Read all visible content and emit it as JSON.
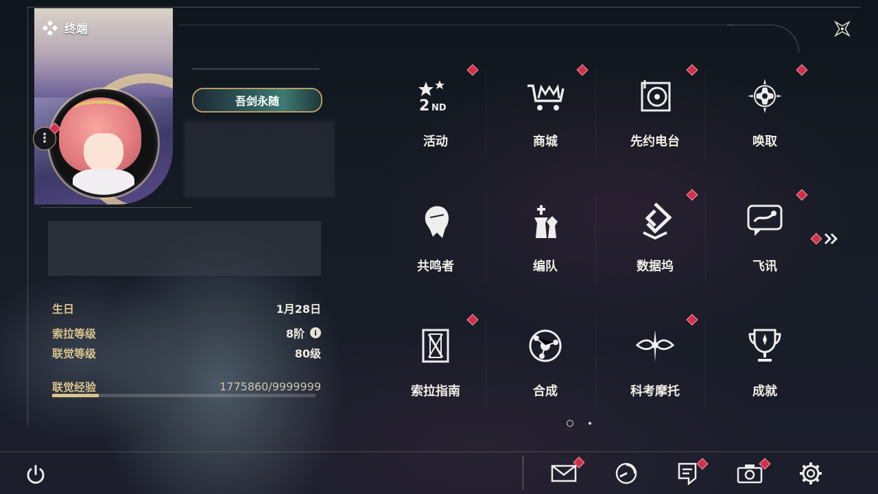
{
  "header": {
    "terminal_label": "终端",
    "close_icon": "close-x-icon"
  },
  "profile": {
    "title_badge": "吾剑永随",
    "avatar": "character-avatar",
    "stats": [
      {
        "label": "生日",
        "value": "1月28日"
      },
      {
        "label": "索拉等级",
        "value": "8阶"
      },
      {
        "label": "联觉等级",
        "value": "80级"
      }
    ],
    "exp": {
      "label": "联觉经验",
      "value": "1775860/9999999",
      "fraction": 0.1776
    }
  },
  "menu": [
    {
      "label": "活动",
      "icon": "event-2nd-anniversary-icon",
      "badge": true
    },
    {
      "label": "商城",
      "icon": "shop-cart-icon",
      "badge": true
    },
    {
      "label": "先约电台",
      "icon": "radio-record-icon",
      "badge": true
    },
    {
      "label": "唤取",
      "icon": "convene-compass-icon",
      "badge": true
    },
    {
      "label": "共鸣者",
      "icon": "resonator-head-icon",
      "badge": false
    },
    {
      "label": "编队",
      "icon": "team-chess-icon",
      "badge": false
    },
    {
      "label": "数据坞",
      "icon": "data-bank-icon",
      "badge": true
    },
    {
      "label": "飞讯",
      "icon": "message-bubble-icon",
      "badge": true
    },
    {
      "label": "索拉指南",
      "icon": "guide-book-icon",
      "badge": true
    },
    {
      "label": "合成",
      "icon": "synthesis-orb-icon",
      "badge": false
    },
    {
      "label": "科考摩托",
      "icon": "motorbike-icon",
      "badge": true
    },
    {
      "label": "成就",
      "icon": "trophy-icon",
      "badge": false
    }
  ],
  "pagination": {
    "current": 1,
    "total": 2
  },
  "bottom_bar": [
    {
      "name": "mail",
      "icon": "mail-icon",
      "badge": true
    },
    {
      "name": "time",
      "icon": "clock-icon",
      "badge": false
    },
    {
      "name": "notice",
      "icon": "notice-icon",
      "badge": true
    },
    {
      "name": "photo",
      "icon": "camera-icon",
      "badge": true
    },
    {
      "name": "settings",
      "icon": "gear-icon",
      "badge": false
    }
  ],
  "colors": {
    "accent_gold": "#d8c48d",
    "badge_red": "#d1304a"
  }
}
